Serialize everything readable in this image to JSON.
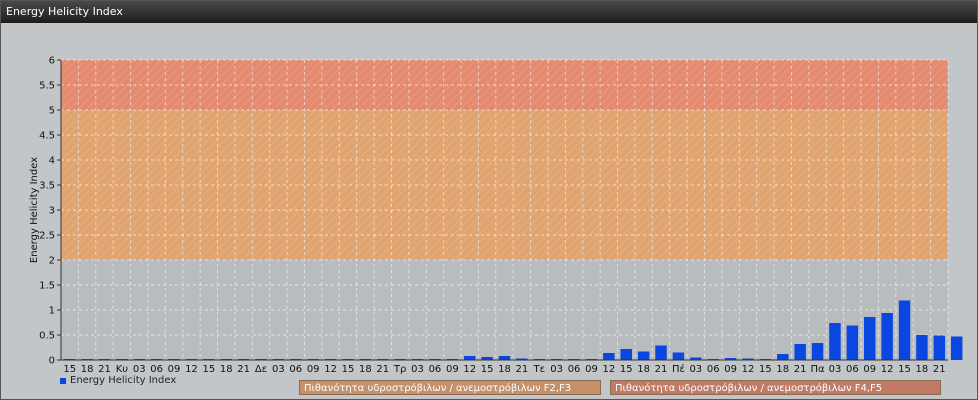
{
  "window": {
    "title": "Energy Helicity Index"
  },
  "legend": {
    "series_label": "Energy Helicity Index"
  },
  "bands": {
    "f2f3": {
      "label": "Πιθανότητα υδροστρόβιλων / ανεμοστρόβιλων F2,F3",
      "from": 2,
      "to": 5,
      "color": "#e0a470"
    },
    "f4f5": {
      "label": "Πιθανότητα υδροστρόβιλων / ανεμοστρόβιλων F4,F5",
      "from": 5,
      "to": 6,
      "color": "#e48a70"
    }
  },
  "chart_data": {
    "type": "bar",
    "ylabel": "Energy Helicity Index",
    "ylim": [
      0,
      6
    ],
    "yticks": [
      "0",
      "0.5",
      "1",
      "1.5",
      "2",
      "2.5",
      "3",
      "3.5",
      "4",
      "4.5",
      "5",
      "5.5",
      "6"
    ],
    "grid": true,
    "legend_position": "bottom-left",
    "series_color": "#0a46e0",
    "categories": [
      "15",
      "18",
      "21",
      "Κυ",
      "03",
      "06",
      "09",
      "12",
      "15",
      "18",
      "21",
      "Δε",
      "03",
      "06",
      "09",
      "12",
      "15",
      "18",
      "21",
      "Τρ",
      "03",
      "06",
      "09",
      "12",
      "15",
      "18",
      "21",
      "Τε",
      "03",
      "06",
      "09",
      "12",
      "15",
      "18",
      "21",
      "Πέ",
      "03",
      "06",
      "09",
      "12",
      "15",
      "18",
      "21",
      "Πα",
      "03",
      "06",
      "09",
      "12",
      "15",
      "18",
      "21"
    ],
    "series": [
      {
        "name": "Energy Helicity Index",
        "values": [
          0.01,
          0.01,
          0.01,
          0.01,
          0.01,
          0.01,
          0.01,
          0.01,
          0.01,
          0.01,
          0.01,
          0.01,
          0.01,
          0.01,
          0.01,
          0.01,
          0.01,
          0.01,
          0.01,
          0.01,
          0.01,
          0.01,
          0.01,
          0.08,
          0.06,
          0.08,
          0.03,
          0.02,
          0.01,
          0.01,
          0.01,
          0.14,
          0.22,
          0.17,
          0.29,
          0.15,
          0.05,
          0.01,
          0.04,
          0.03,
          0.01,
          0.12,
          0.32,
          0.34,
          0.74,
          0.69,
          0.86,
          0.94,
          1.19,
          0.5,
          0.49,
          0.47
        ]
      }
    ]
  }
}
